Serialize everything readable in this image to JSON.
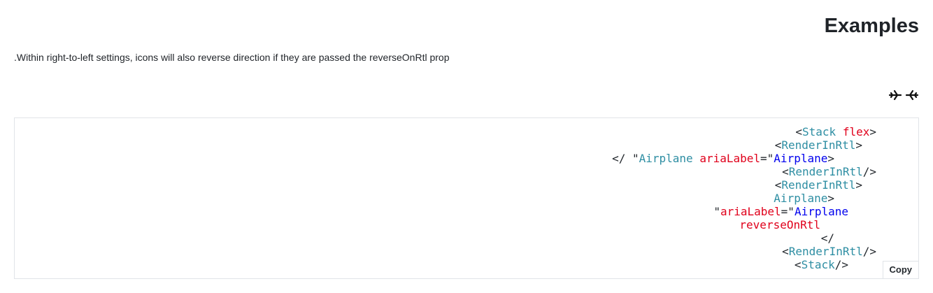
{
  "page": {
    "title": "Examples",
    "description": ".Within right-to-left settings, icons will also reverse direction if they are passed the reverseOnRtl prop"
  },
  "preview": {
    "icons": [
      "airplane-icon",
      "airplane-icon"
    ]
  },
  "code": {
    "lines": [
      [
        {
          "t": "<",
          "c": "punct"
        },
        {
          "t": "Stack",
          "c": "tag"
        },
        {
          "t": " ",
          "c": "punct"
        },
        {
          "t": "flex",
          "c": "attr"
        },
        {
          "t": ">",
          "c": "punct"
        }
      ],
      [
        {
          "t": "<",
          "c": "punct"
        },
        {
          "t": "RenderInRtl",
          "c": "tag"
        },
        {
          "t": ">",
          "c": "punct"
        }
      ],
      [
        {
          "t": "</ \"",
          "c": "punct"
        },
        {
          "t": "Airplane",
          "c": "tag"
        },
        {
          "t": " ",
          "c": "punct"
        },
        {
          "t": "ariaLabel",
          "c": "attr"
        },
        {
          "t": "=\"",
          "c": "punct"
        },
        {
          "t": "Airplane",
          "c": "str"
        },
        {
          "t": ">",
          "c": "punct"
        }
      ],
      [
        {
          "t": "<",
          "c": "punct"
        },
        {
          "t": "RenderInRtl",
          "c": "tag"
        },
        {
          "t": "/>",
          "c": "punct"
        }
      ],
      [
        {
          "t": "<",
          "c": "punct"
        },
        {
          "t": "RenderInRtl",
          "c": "tag"
        },
        {
          "t": ">",
          "c": "punct"
        }
      ],
      [
        {
          "t": "Airplane",
          "c": "tag"
        },
        {
          "t": ">",
          "c": "punct"
        }
      ],
      [
        {
          "t": "\"",
          "c": "punct"
        },
        {
          "t": "ariaLabel",
          "c": "attr"
        },
        {
          "t": "=\"",
          "c": "punct"
        },
        {
          "t": "Airplane",
          "c": "str"
        }
      ],
      [
        {
          "t": "reverseOnRtl",
          "c": "attr"
        }
      ],
      [
        {
          "t": "</",
          "c": "punct"
        }
      ],
      [
        {
          "t": "<",
          "c": "punct"
        },
        {
          "t": "RenderInRtl",
          "c": "tag"
        },
        {
          "t": "/>",
          "c": "punct"
        }
      ],
      [
        {
          "t": "<",
          "c": "punct"
        },
        {
          "t": "Stack",
          "c": "tag"
        },
        {
          "t": "/>",
          "c": "punct"
        }
      ]
    ],
    "indents": [
      0,
      1,
      3,
      0,
      1,
      3,
      2,
      4,
      3,
      0,
      2
    ],
    "copy_label": "Copy"
  },
  "colors": {
    "tag": "#2e8ea3",
    "attr": "#e0001b",
    "string": "#0000ee",
    "text": "#24292e",
    "border": "#e1e4e8"
  }
}
